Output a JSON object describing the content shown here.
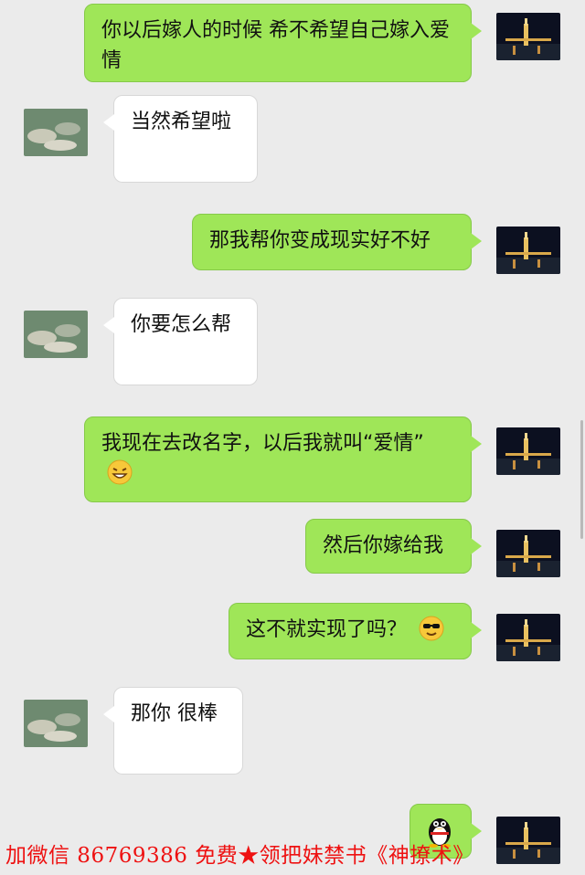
{
  "messages": [
    {
      "side": "me",
      "text": "你以后嫁人的时候 希不希望自己嫁入爱情"
    },
    {
      "side": "them",
      "text": "当然希望啦"
    },
    {
      "side": "me",
      "text": "那我帮你变成现实好不好"
    },
    {
      "side": "them",
      "text": "你要怎么帮"
    },
    {
      "side": "me",
      "text": "我现在去改名字，以后我就叫“爱情”",
      "emoji": "grin-emoji"
    },
    {
      "side": "me",
      "text": "然后你嫁给我"
    },
    {
      "side": "me",
      "text": "这不就实现了吗？",
      "emoji": "sunglasses-emoji"
    },
    {
      "side": "them",
      "text": "那你 很棒"
    },
    {
      "side": "me",
      "text": "",
      "emoji": "penguin-sticker"
    }
  ],
  "footer": {
    "text": "加微信 86769386 免费★领把妹禁书《神撩术》"
  },
  "colors": {
    "me_bubble": "#9fe658",
    "them_bubble": "#ffffff",
    "background": "#ebebeb",
    "footer_text": "#ee1111"
  }
}
